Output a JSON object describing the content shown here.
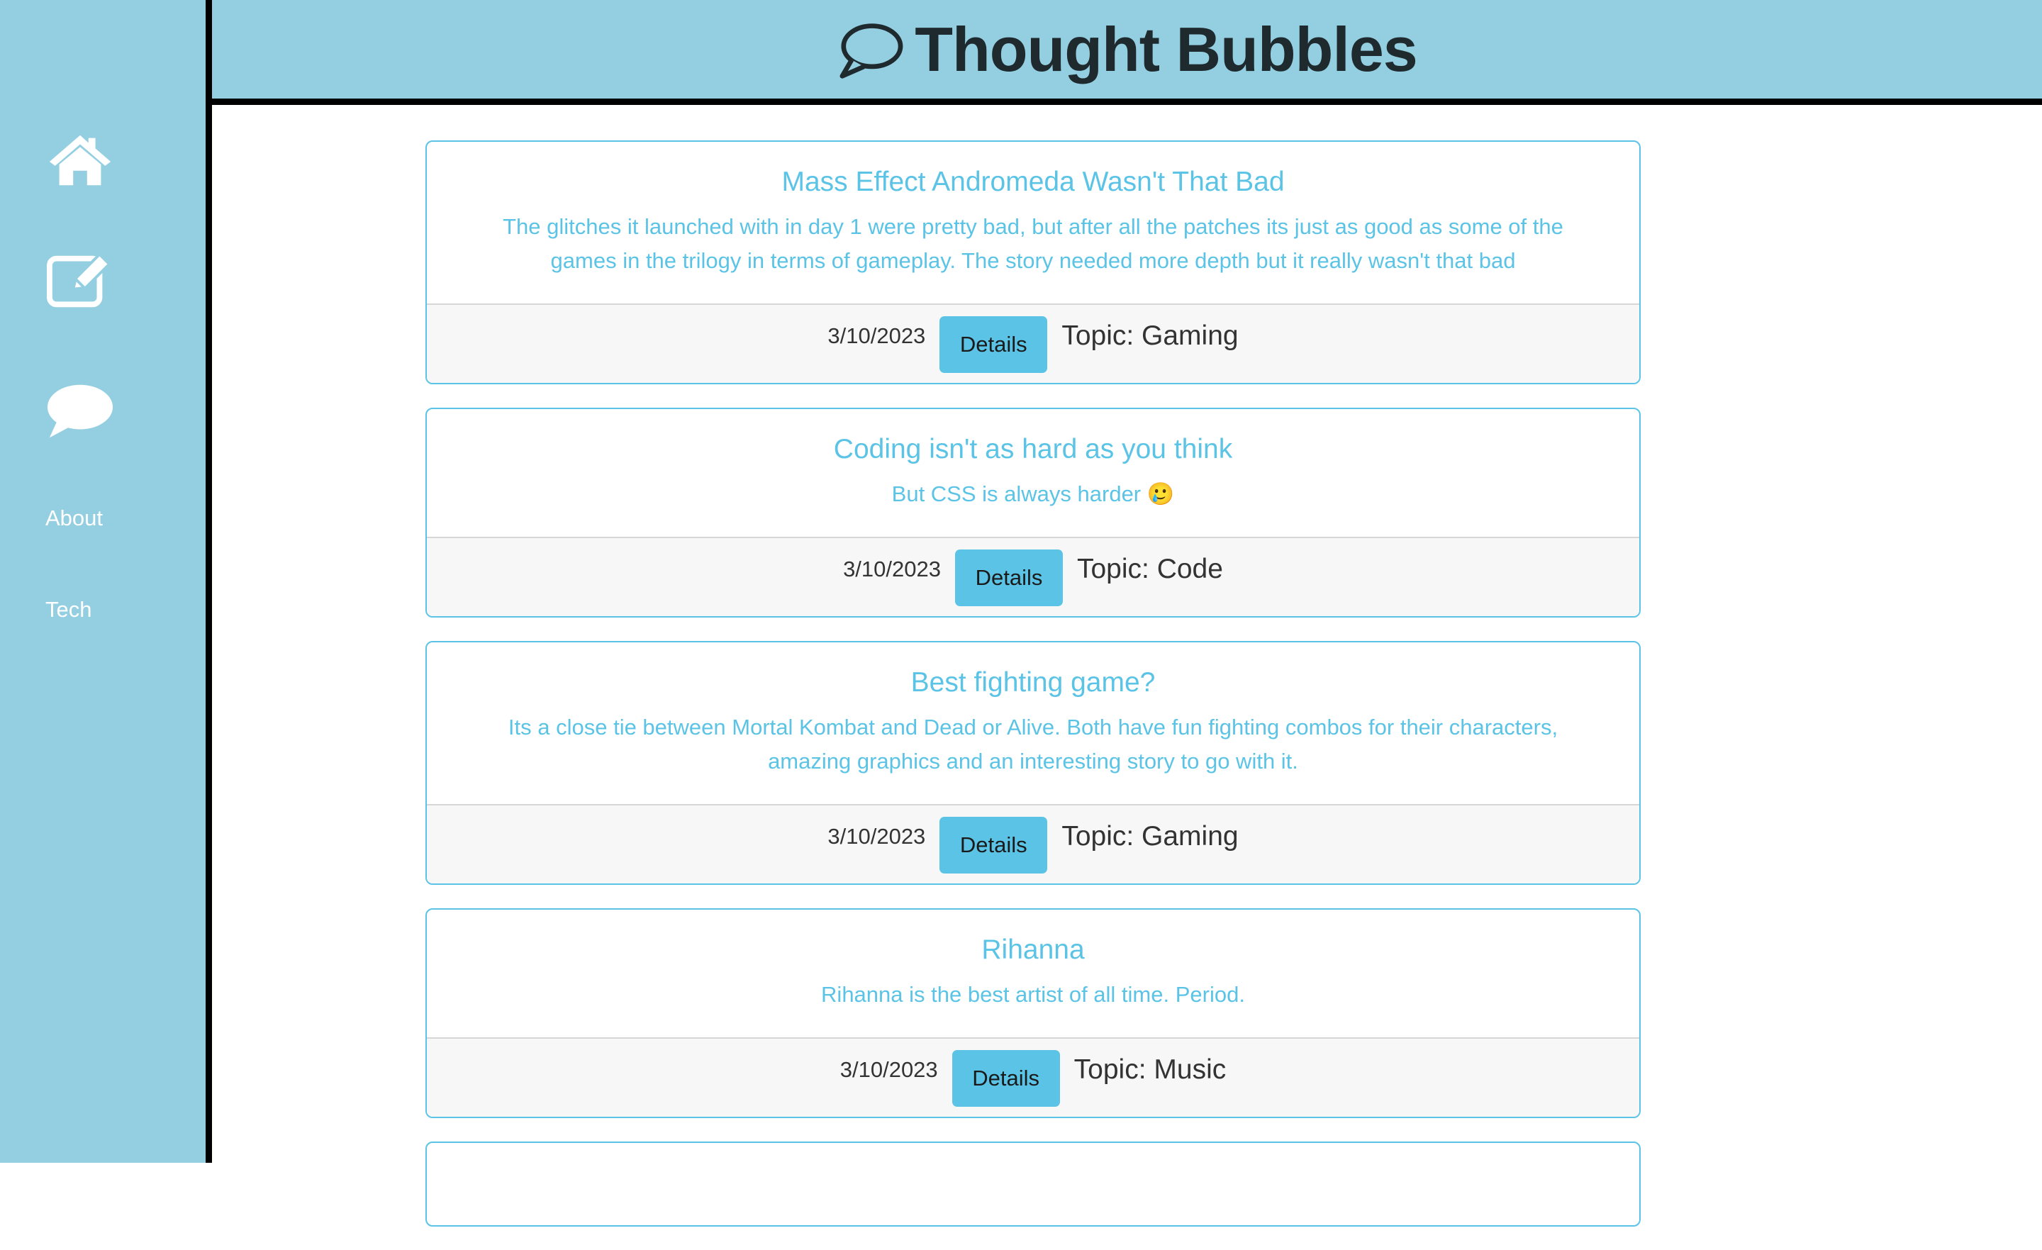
{
  "app": {
    "title": "Thought Bubbles",
    "brand_color": "#94cfe1",
    "accent_color": "#5bc4e6",
    "title_icon": "speech-bubble-outline-icon"
  },
  "sidebar": {
    "icons": [
      "home-icon",
      "edit-icon",
      "speech-bubble-icon"
    ],
    "links": [
      {
        "label": "About"
      },
      {
        "label": "Tech"
      }
    ]
  },
  "posts": [
    {
      "title": "Mass Effect Andromeda Wasn't That Bad",
      "body": "The glitches it launched with in day 1 were pretty bad, but after all the patches its just as good as some of the games in the trilogy in terms of gameplay. The story needed more depth but it really wasn't that bad",
      "date": "3/10/2023",
      "button": "Details",
      "topic": "Topic: Gaming"
    },
    {
      "title": "Coding isn't as hard as you think",
      "body": "But CSS is always harder 🥲",
      "date": "3/10/2023",
      "button": "Details",
      "topic": "Topic: Code"
    },
    {
      "title": "Best fighting game?",
      "body": "Its a close tie between Mortal Kombat and Dead or Alive. Both have fun fighting combos for their characters, amazing graphics and an interesting story to go with it.",
      "date": "3/10/2023",
      "button": "Details",
      "topic": "Topic: Gaming"
    },
    {
      "title": "Rihanna",
      "body": "Rihanna is the best artist of all time. Period.",
      "date": "3/10/2023",
      "button": "Details",
      "topic": "Topic: Music"
    }
  ]
}
